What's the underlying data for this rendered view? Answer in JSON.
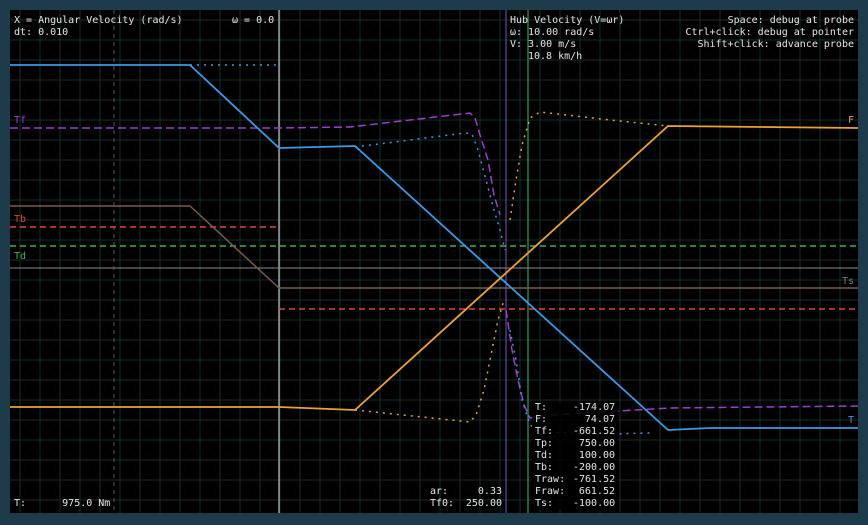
{
  "chart_data": {
    "type": "line",
    "title": "X = Angular Velocity (rad/s)",
    "xlabel": "Angular Velocity (rad/s)",
    "omega_axis_label": "ω = 0.0",
    "dt_label": "dt: 0.010",
    "hub_panel": {
      "title": "Hub Velocity (V=ωr)",
      "omega": "ω: 10.00 rad/s",
      "v": "V: 3.00 m/s",
      "kmh": "10.8 km/h"
    },
    "help": [
      "Space: debug at probe",
      "Ctrl+click: debug at pointer",
      "Shift+click: advance probe"
    ],
    "bottom_left": "T:      975.0 Nm",
    "ar_label": "ar:",
    "ar_value": "0.33",
    "tf0_label": "Tf0:",
    "tf0_value": "250.00",
    "probe_values": [
      {
        "label": "T:",
        "value": "-174.07"
      },
      {
        "label": "F:",
        "value": "74.07"
      },
      {
        "label": "Tf:",
        "value": "-661.52"
      },
      {
        "label": "Tp:",
        "value": "750.00"
      },
      {
        "label": "Td:",
        "value": "100.00"
      },
      {
        "label": "Tb:",
        "value": "-200.00"
      },
      {
        "label": "Traw:",
        "value": "-761.52"
      },
      {
        "label": "Fraw:",
        "value": "661.52"
      },
      {
        "label": "Ts:",
        "value": "-100.00"
      }
    ],
    "series": [
      {
        "name": "Tf",
        "color": "#a03ad0"
      },
      {
        "name": "Tb",
        "color": "#e0443c"
      },
      {
        "name": "Td",
        "color": "#3cb44a"
      },
      {
        "name": "Ts",
        "color": "#7a7a7a"
      },
      {
        "name": "F",
        "color": "#f0a030"
      },
      {
        "name": "T",
        "color": "#3a9ae8"
      }
    ],
    "line_colors": {
      "brown": "#7a5a48",
      "hub_line": "#7a50c8",
      "probe_line": "#36c070",
      "zero_line": "#e6e6e6",
      "grid": "#12302a"
    }
  }
}
